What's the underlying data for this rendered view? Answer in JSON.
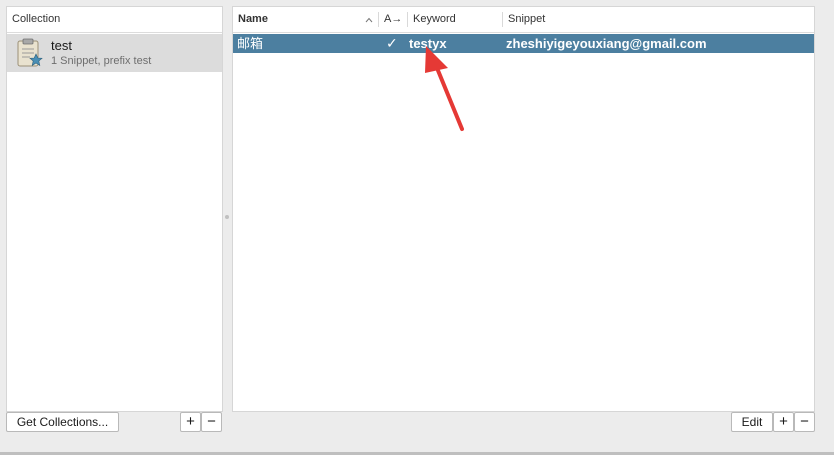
{
  "collections_panel": {
    "header": "Collection",
    "items": [
      {
        "name": "test",
        "subtitle": "1 Snippet, prefix test",
        "icon": "clipboard-snippet-icon"
      }
    ],
    "get_button": "Get Collections...",
    "add_button": "+",
    "remove_button": "−"
  },
  "snippets_panel": {
    "columns": {
      "name": "Name",
      "auto_expand": "A→",
      "keyword": "Keyword",
      "snippet": "Snippet"
    },
    "rows": [
      {
        "name": "邮箱",
        "auto_expand": "✓",
        "keyword": "testyx",
        "snippet": "zheshiyigeyouxiang@gmail.com"
      }
    ],
    "edit_button": "Edit",
    "add_button": "+",
    "remove_button": "−"
  },
  "colors": {
    "selection": "#4c7fa0",
    "annotation_arrow": "#e53935"
  }
}
